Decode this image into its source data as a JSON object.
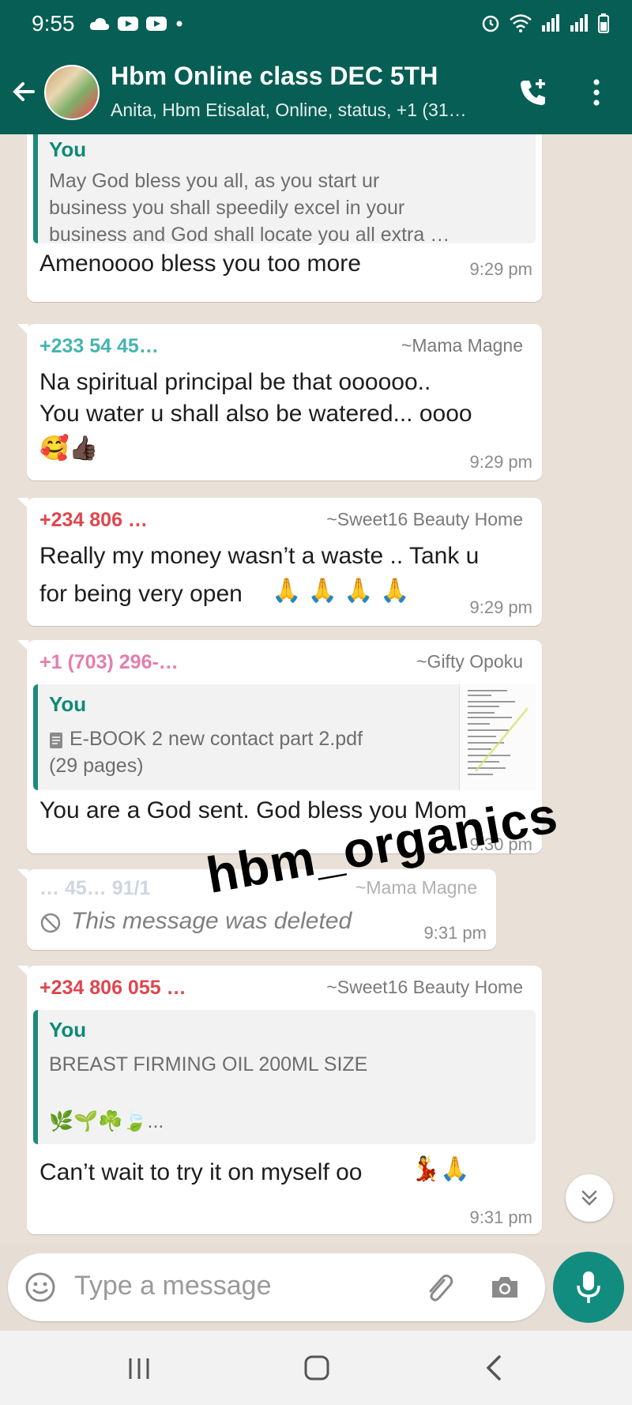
{
  "status_bar": {
    "time": "9:55"
  },
  "header": {
    "title": "Hbm Online class DEC 5TH",
    "subtitle": "Anita, Hbm Etisalat, Online, status, +1 (31…"
  },
  "messages": [
    {
      "quote_sender": "You",
      "quote_text": [
        "May God bless you all, as you start ur",
        "business you shall speedily excel in your",
        "business and God shall locate you all extra …"
      ],
      "text": "Amenoooo bless you too more",
      "time": "9:29 pm"
    },
    {
      "sender": "+233 54 45…",
      "alias": "~Mama Magne",
      "text_lines": [
        "Na spiritual principal be that oooooo..",
        "You water u shall also be watered... oooo"
      ],
      "emojis": "🥰👍🏿",
      "time": "9:29 pm"
    },
    {
      "sender": "+234 806 …",
      "alias": "~Sweet16 Beauty Home",
      "text_lines": [
        "Really my money wasn’t a waste .. Tank u",
        "for being very open"
      ],
      "emojis": "🙏 🙏 🙏 🙏",
      "time": "9:29 pm"
    },
    {
      "sender": "+1 (703) 296-…",
      "alias": "~Gifty Opoku",
      "quote_sender": "You",
      "quote_file": "E-BOOK 2 new contact part 2.pdf",
      "quote_pages": "(29 pages)",
      "text": "You are  a God sent.  God bless you Mom",
      "time": "9:30 pm"
    },
    {
      "sender": "… 45… 91/1",
      "alias": "~Mama Magne",
      "text": "This message was deleted",
      "time": "9:31 pm"
    },
    {
      "sender": "+234 806 055 …",
      "alias": "~Sweet16 Beauty Home",
      "quote_sender": "You",
      "quote_text": [
        "BREAST FIRMING  OIL 200ML SIZE"
      ],
      "quote_emojis": "🌿🌱☘️🍃...",
      "text": "Can’t wait to try it on myself oo",
      "emojis": "💃🙏",
      "time": "9:31 pm"
    }
  ],
  "watermark": "hbm_organics",
  "composer": {
    "placeholder": "Type a message"
  },
  "colors": {
    "header": "#075e54",
    "accent": "#128c7e",
    "quote_bar": "#1c8a7c"
  }
}
